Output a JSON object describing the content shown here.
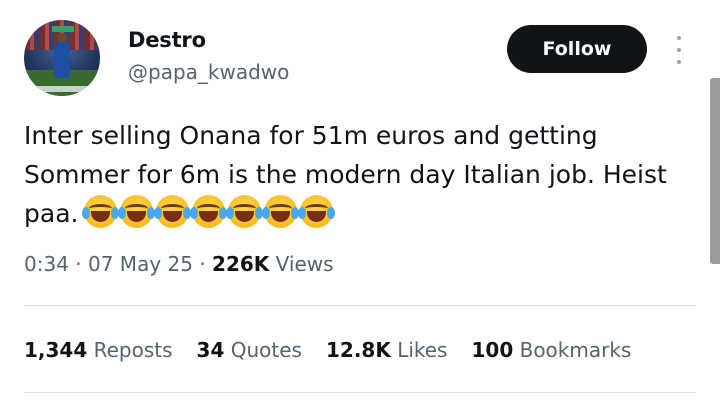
{
  "author": {
    "name": "Destro",
    "handle": "@papa_kwadwo",
    "avatar": "avatar-photo"
  },
  "actions": {
    "follow_label": "Follow",
    "more_icon": "more-vertical-icon"
  },
  "tweet": {
    "text": "Inter selling Onana for 51m euros and getting Sommer for 6m is the modern day Italian job.  Heist paa.",
    "emoji": [
      "😂",
      "😂",
      "😂",
      "😂",
      "😂",
      "😂",
      "😂"
    ]
  },
  "meta": {
    "time": "0:34",
    "sep1": "·",
    "date": "07 May 25",
    "sep2": "·",
    "views_count": "226K",
    "views_label": "Views"
  },
  "stats": [
    {
      "count": "1,344",
      "label": "Reposts"
    },
    {
      "count": "34",
      "label": "Quotes"
    },
    {
      "count": "12.8K",
      "label": "Likes"
    },
    {
      "count": "100",
      "label": "Bookmarks"
    }
  ],
  "colors": {
    "text": "#0f1419",
    "secondary": "#536471",
    "button_bg": "#0f1419",
    "divider": "#e1e5e8"
  }
}
